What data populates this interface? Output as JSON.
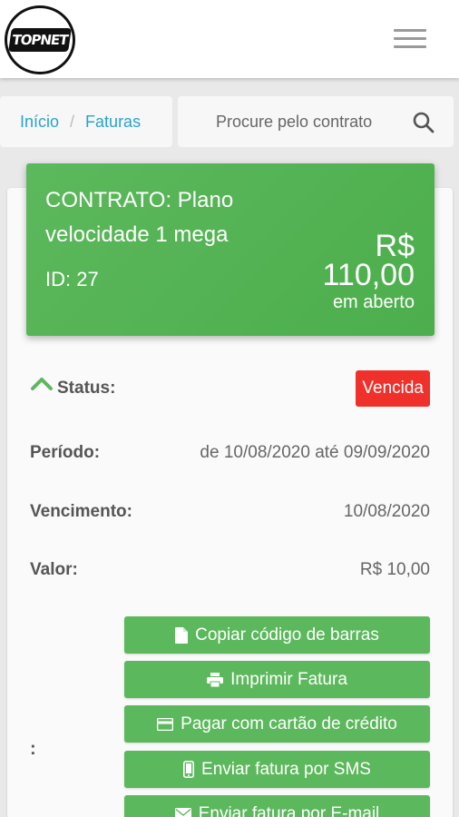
{
  "header": {
    "logo_text": "TOPNET"
  },
  "breadcrumb": {
    "items": [
      "Início",
      "Faturas"
    ],
    "separator": "/"
  },
  "search": {
    "placeholder": "Procure pelo contrato"
  },
  "contract": {
    "title": "CONTRATO: Plano velocidade 1 mega",
    "id_label": "ID: 27",
    "currency": "R$",
    "amount": "110,00",
    "status": "em aberto"
  },
  "invoice": {
    "status_label": "Status:",
    "status_value": "Vencida",
    "period_label": "Período:",
    "period_value": "de 10/08/2020 até 09/09/2020",
    "due_label": "Vencimento:",
    "due_value": "10/08/2020",
    "value_label": "Valor:",
    "value_value": "R$ 10,00",
    "actions_label": ":"
  },
  "actions": {
    "copy_barcode": "Copiar código de barras",
    "print": "Imprimir Fatura",
    "pay_card": "Pagar com cartão de crédito",
    "send_sms": "Enviar fatura por SMS",
    "send_email": "Enviar fatura por E-mail"
  },
  "colors": {
    "primary_green": "#5cb85c",
    "danger_red": "#f0302a",
    "link_blue": "#29a3cc"
  },
  "icons": [
    "hamburger-menu-icon",
    "search-icon",
    "chevron-up-icon",
    "document-icon",
    "printer-icon",
    "credit-card-icon",
    "smartphone-icon",
    "envelope-icon"
  ]
}
